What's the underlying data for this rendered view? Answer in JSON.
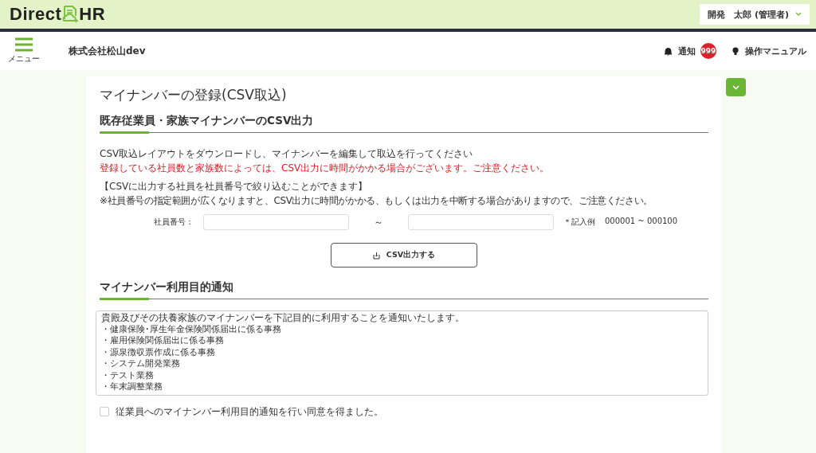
{
  "header": {
    "logo_left": "Direct",
    "logo_right": "HR",
    "user": "開発　太郎 (管理者)"
  },
  "nav": {
    "menu_label": "メニュー",
    "company": "株式会社松山dev",
    "notification_label": "通知",
    "notification_count": "999",
    "manual_label": "操作マニュアル"
  },
  "page": {
    "title": "マイナンバーの登録(CSV取込)",
    "export_section": {
      "heading": "既存従業員・家族マイナンバーのCSV出力",
      "instruction": "CSV取込レイアウトをダウンロードし、マイナンバーを編集して取込を行ってください",
      "warning": "登録している社員数と家族数によっては、CSV出力に時間がかかる場合がございます。ご注意ください。",
      "filter_heading": "【CSVに出力する社員を社員番号で絞り込むことができます】",
      "filter_note": "※社員番号の指定範囲が広くなりますと、CSV出力に時間がかかる、もしくは出力を中断する場合がありますので、ご注意ください。",
      "field_label": "社員番号：",
      "range_separator": "～",
      "example_label": "＊記入例",
      "example_value": "000001 ~ 000100",
      "button": "CSV出力する"
    },
    "purpose_section": {
      "heading": "マイナンバー利用目的通知",
      "notice_lines": [
        "貴殿及びその扶養家族のマイナンバーを下記目的に利用することを通知いたします。",
        "・健康保険･厚生年金保険関係届出に係る事務",
        "・雇用保険関係届出に係る事務",
        "・源泉徴収票作成に係る事務",
        "・システム開発業務",
        "・テスト業務",
        "・年末調整業務"
      ],
      "consent": {
        "label": "従業員へのマイナンバー利用目的通知を行い同意を得ました。",
        "checked": false
      }
    }
  }
}
